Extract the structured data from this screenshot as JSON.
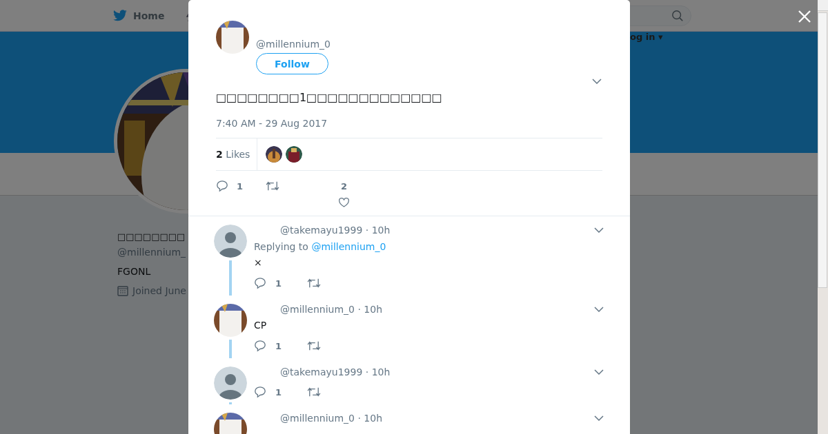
{
  "nav": {
    "home": "Home",
    "login": "og in ▾"
  },
  "profile": {
    "name": "□□□□□□□□",
    "handle": "@millennium_",
    "bio": "FGONL",
    "joined": "Joined June"
  },
  "tweet": {
    "handle": "@millennium_0",
    "follow": "Follow",
    "text": "□□□□□□□□1□□□□□□□□□□□□□",
    "time": "7:40 AM - 29 Aug 2017",
    "likes_count": "2",
    "likes_label": "Likes",
    "reply_count": "1",
    "like_count": "2"
  },
  "replies": [
    {
      "handle": "@takemayu1999 · 10h",
      "replying_label": "Replying to",
      "replying_to": "@millennium_0",
      "text": "×",
      "reply_count": "1",
      "kind": "default"
    },
    {
      "handle": "@millennium_0 · 10h",
      "text": "CP",
      "reply_count": "1",
      "kind": "picture"
    },
    {
      "handle": "@takemayu1999 · 10h",
      "reply_count": "1",
      "kind": "default"
    },
    {
      "handle": "@millennium_0 · 10h",
      "kind": "picture"
    }
  ]
}
